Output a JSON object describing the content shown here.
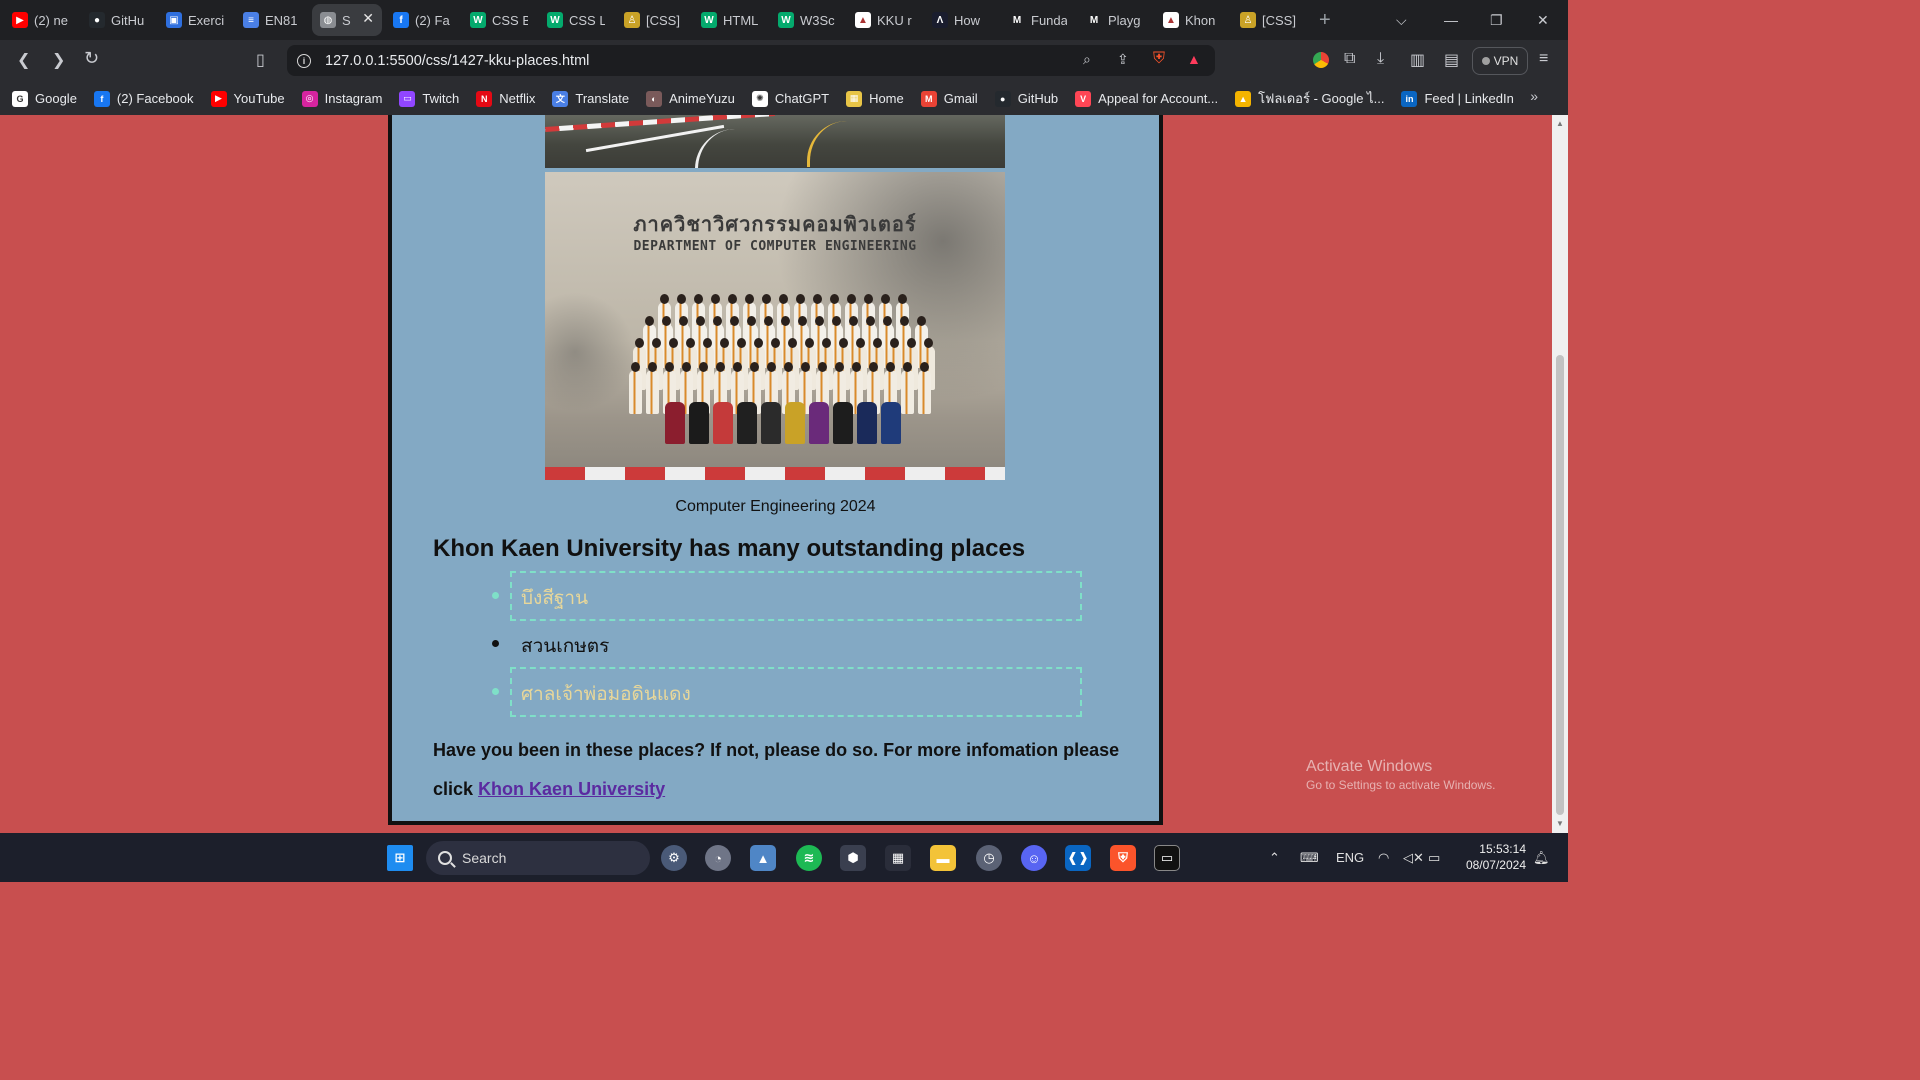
{
  "browser": {
    "tabs": [
      {
        "label": "(2) ne",
        "icon": "youtube-icon",
        "color": "#ff0000",
        "glyph": "▶"
      },
      {
        "label": "GitHu",
        "icon": "github-icon",
        "color": "#24292e",
        "glyph": "●"
      },
      {
        "label": "Exerci",
        "icon": "classroom-icon",
        "color": "#2f6fde",
        "glyph": "▣"
      },
      {
        "label": "EN81",
        "icon": "docs-icon",
        "color": "#4a7fe5",
        "glyph": "≡"
      },
      {
        "label": "S",
        "icon": "globe-icon",
        "color": "#8a8d92",
        "glyph": "◍",
        "active": true
      },
      {
        "label": "(2) Fa",
        "icon": "facebook-icon",
        "color": "#1877f2",
        "glyph": "f"
      },
      {
        "label": "CSS B",
        "icon": "w3schools-icon",
        "color": "#04aa6d",
        "glyph": "W"
      },
      {
        "label": "CSS L",
        "icon": "w3schools-icon",
        "color": "#04aa6d",
        "glyph": "W"
      },
      {
        "label": "[CSS]",
        "icon": "course-icon",
        "color": "#c9a227",
        "glyph": "♙"
      },
      {
        "label": "HTML",
        "icon": "w3schools-icon",
        "color": "#04aa6d",
        "glyph": "W"
      },
      {
        "label": "W3Sc",
        "icon": "w3schools-icon",
        "color": "#04aa6d",
        "glyph": "W"
      },
      {
        "label": "KKU r",
        "icon": "kku-icon",
        "color": "#ffffff",
        "glyph": "▲"
      },
      {
        "label": "How",
        "icon": "perplexity-icon",
        "color": "#1a1d2e",
        "glyph": "Λ"
      },
      {
        "label": "Funda",
        "icon": "mdn-icon",
        "color": "#1f2023",
        "glyph": "M"
      },
      {
        "label": "Playg",
        "icon": "mdn-icon",
        "color": "#1f2023",
        "glyph": "M"
      },
      {
        "label": "Khon",
        "icon": "kku-icon",
        "color": "#ffffff",
        "glyph": "▲"
      },
      {
        "label": "[CSS]",
        "icon": "course-icon",
        "color": "#c9a227",
        "glyph": "♙"
      }
    ],
    "url": "127.0.0.1:5500/css/1427-kku-places.html",
    "vpn_label": "VPN",
    "bookmarks": [
      {
        "label": "Google",
        "icon": "google-icon",
        "color": "#ffffff",
        "glyph": "G"
      },
      {
        "label": "(2) Facebook",
        "icon": "facebook-icon",
        "color": "#1877f2",
        "glyph": "f"
      },
      {
        "label": "YouTube",
        "icon": "youtube-icon",
        "color": "#ff0000",
        "glyph": "▶"
      },
      {
        "label": "Instagram",
        "icon": "instagram-icon",
        "color": "#d6249f",
        "glyph": "◎"
      },
      {
        "label": "Twitch",
        "icon": "twitch-icon",
        "color": "#9146ff",
        "glyph": "▭"
      },
      {
        "label": "Netflix",
        "icon": "netflix-icon",
        "color": "#e50914",
        "glyph": "N"
      },
      {
        "label": "Translate",
        "icon": "translate-icon",
        "color": "#4a7fe5",
        "glyph": "文"
      },
      {
        "label": "AnimeYuzu",
        "icon": "animeyuzu-icon",
        "color": "#7a5a5a",
        "glyph": "◐"
      },
      {
        "label": "ChatGPT",
        "icon": "chatgpt-icon",
        "color": "#ffffff",
        "glyph": "✺"
      },
      {
        "label": "Home",
        "icon": "home-icon",
        "color": "#e8c547",
        "glyph": "▦"
      },
      {
        "label": "Gmail",
        "icon": "gmail-icon",
        "color": "#ea4335",
        "glyph": "M"
      },
      {
        "label": "GitHub",
        "icon": "github-icon",
        "color": "#24292e",
        "glyph": "●"
      },
      {
        "label": "Appeal for Account...",
        "icon": "valorant-icon",
        "color": "#ff4655",
        "glyph": "V"
      },
      {
        "label": "โฟลเดอร์ - Google ไ...",
        "icon": "google-drive-icon",
        "color": "#f4b400",
        "glyph": "▲"
      },
      {
        "label": "Feed | LinkedIn",
        "icon": "linkedin-icon",
        "color": "#0a66c2",
        "glyph": "in"
      }
    ]
  },
  "page": {
    "image_text_thai": "ภาควิชาวิศวกรรมคอมพิวเตอร์",
    "image_text_en": "DEPARTMENT OF COMPUTER ENGINEERING",
    "caption": "Computer Engineering 2024",
    "heading": "Khon Kaen University has many outstanding places",
    "places": [
      {
        "name": "บึงสีฐาน",
        "style": "boxed"
      },
      {
        "name": "สวนเกษตร",
        "style": "plain"
      },
      {
        "name": "ศาลเจ้าพ่อมอดินแดง",
        "style": "boxed"
      }
    ],
    "outro_text": "Have you been in these places? If not, please do so. For more infomation please click",
    "link_text": "Khon Kaen University",
    "colors": {
      "page_bg": "#c84f4f",
      "card_bg": "#83a9c4",
      "dashed_border": "#7fe0c8",
      "boxed_text": "#e8d79a",
      "link": "#5b2aa0"
    }
  },
  "windows": {
    "watermark_title": "Activate Windows",
    "watermark_sub": "Go to Settings to activate Windows.",
    "search_placeholder": "Search",
    "language": "ENG",
    "time": "15:53:14",
    "date": "08/07/2024"
  }
}
